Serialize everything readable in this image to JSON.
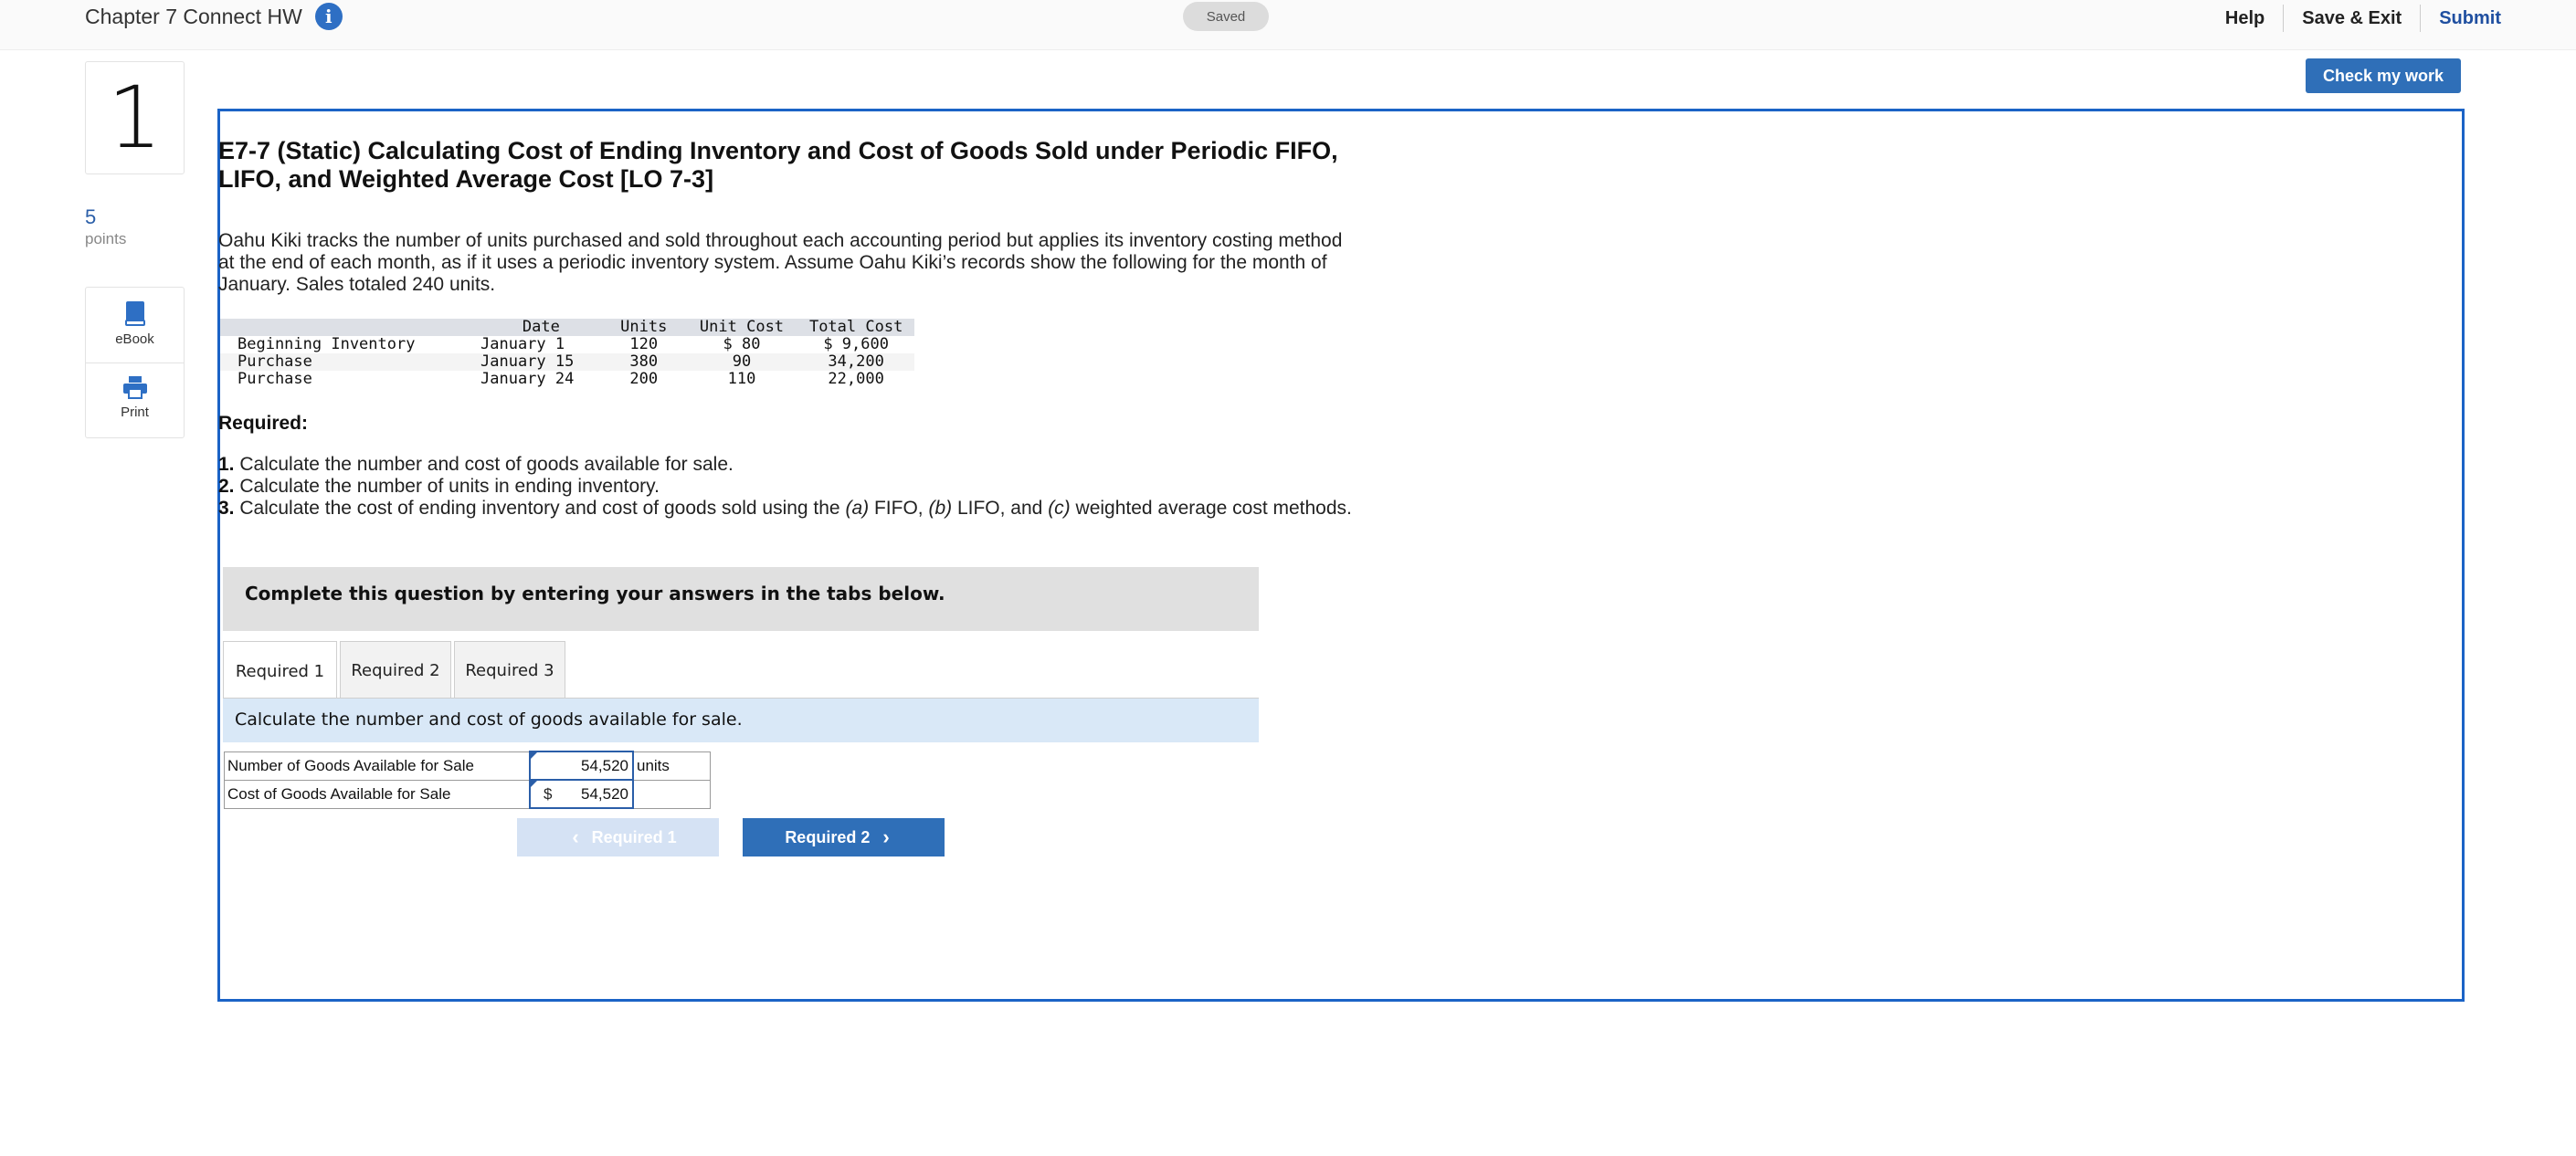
{
  "header": {
    "title": "Chapter 7 Connect HW",
    "status": "Saved",
    "links": {
      "help": "Help",
      "save_exit": "Save & Exit",
      "submit": "Submit"
    }
  },
  "sidebar": {
    "question_number": "1",
    "points_value": "5",
    "points_label": "points",
    "tools": {
      "ebook": "eBook",
      "print": "Print"
    }
  },
  "check_button": "Check my work",
  "question": {
    "title": "E7-7 (Static) Calculating Cost of Ending Inventory and Cost of Goods Sold under Periodic FIFO, LIFO, and Weighted Average Cost [LO 7-3]",
    "body": "Oahu Kiki tracks the number of units purchased and sold throughout each accounting period but applies its inventory costing method at the end of each month, as if it uses a periodic inventory system. Assume Oahu Kiki’s records show the following for the month of January. Sales totaled 240 units.",
    "table": {
      "headers": [
        "",
        "Date",
        "Units",
        "Unit Cost",
        "Total Cost"
      ],
      "rows": [
        [
          "Beginning Inventory",
          "January 1",
          "120",
          "$ 80",
          "$ 9,600"
        ],
        [
          "Purchase",
          "January 15",
          "380",
          "90",
          "34,200"
        ],
        [
          "Purchase",
          "January 24",
          "200",
          "110",
          "22,000"
        ]
      ]
    },
    "required_heading": "Required:",
    "requirements": [
      {
        "num": "1.",
        "text": "Calculate the number and cost of goods available for sale."
      },
      {
        "num": "2.",
        "text": "Calculate the number of units in ending inventory."
      },
      {
        "num": "3.",
        "text_pre": "Calculate the cost of ending inventory and cost of goods sold using the ",
        "a": "(a)",
        "fifo": " FIFO, ",
        "b": "(b)",
        "lifo": " LIFO, and ",
        "c": "(c)",
        "rest": " weighted average cost methods."
      }
    ]
  },
  "instructions": "Complete this question by entering your answers in the tabs below.",
  "tabs": [
    "Required 1",
    "Required 2",
    "Required 3"
  ],
  "active_tab_instruction": "Calculate the number and cost of goods available for sale.",
  "answers": [
    {
      "label": "Number of Goods Available for Sale",
      "prefix": "",
      "value": "54,520",
      "unit": "units"
    },
    {
      "label": "Cost of Goods Available for Sale",
      "prefix": "$",
      "value": "54,520",
      "unit": ""
    }
  ],
  "nav": {
    "prev": "Required 1",
    "next": "Required 2"
  },
  "colors": {
    "accent": "#1b63c6",
    "button": "#2f6fb8",
    "info_icon": "#2e6fc4",
    "submit_link": "#1f4fa0"
  }
}
